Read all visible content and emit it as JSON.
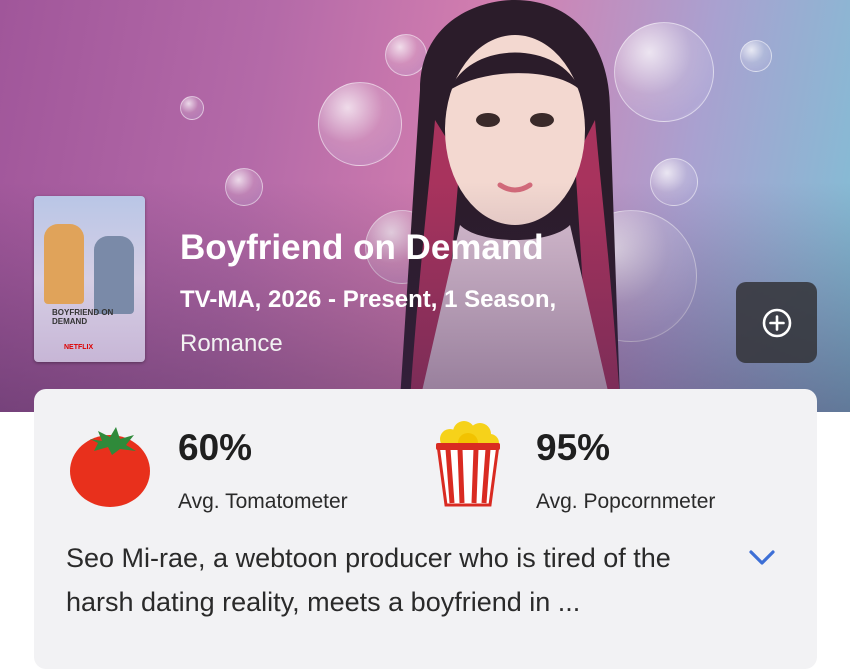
{
  "show": {
    "title": "Boyfriend on Demand",
    "meta": "TV-MA, 2026 - Present, 1 Season,",
    "genre": "Romance",
    "poster_text": "BOYFRIEND ON DEMAND",
    "poster_brand": "NETFLIX"
  },
  "actions": {
    "add_icon": "plus-circle-icon"
  },
  "scores": {
    "tomatometer": {
      "value": "60%",
      "label": "Avg. Tomatometer",
      "icon": "tomato-icon"
    },
    "popcornmeter": {
      "value": "95%",
      "label": "Avg. Popcornmeter",
      "icon": "popcorn-icon"
    }
  },
  "synopsis": {
    "text": "Seo Mi-rae, a webtoon producer who is tired of the harsh dating reality, meets a boyfriend in ...",
    "expand_icon": "chevron-down-icon"
  },
  "colors": {
    "accent": "#3d6fd6",
    "tomato": "#e8301c",
    "popcorn_red": "#d92b22",
    "card_bg": "#f2f2f4"
  }
}
